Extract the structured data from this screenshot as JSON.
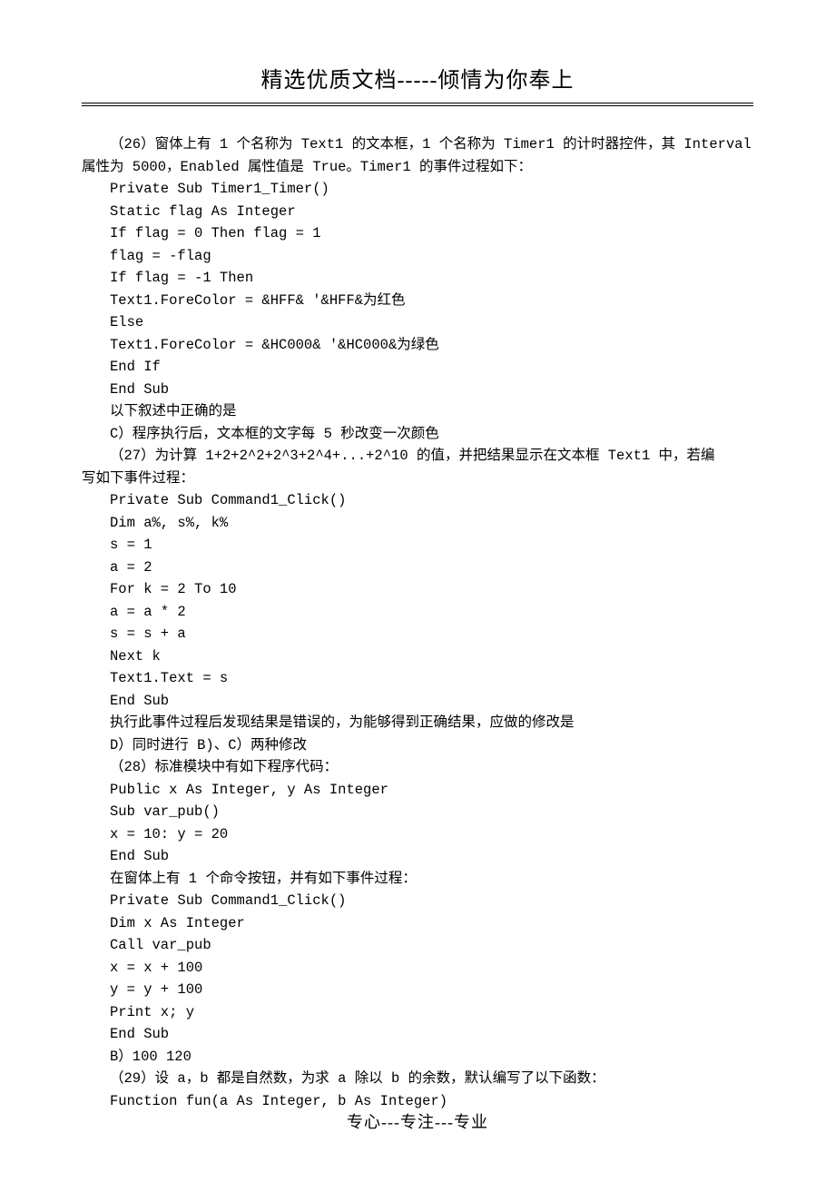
{
  "header": {
    "title": "精选优质文档-----倾情为你奉上"
  },
  "lines": [
    {
      "cls": "para",
      "t": "（26）窗体上有 1 个名称为 Text1 的文本框，1 个名称为 Timer1 的计时器控件，其 Interval"
    },
    {
      "cls": "",
      "t": "属性为 5000，Enabled 属性值是 True。Timer1 的事件过程如下："
    },
    {
      "cls": "code",
      "t": "Private Sub Timer1_Timer()"
    },
    {
      "cls": "code",
      "t": "Static flag As Integer"
    },
    {
      "cls": "code",
      "t": "If flag = 0 Then flag = 1"
    },
    {
      "cls": "code",
      "t": "flag = -flag"
    },
    {
      "cls": "code",
      "t": "If flag = -1 Then"
    },
    {
      "cls": "code",
      "t": "Text1.ForeColor = &HFF& '&HFF&为红色"
    },
    {
      "cls": "code",
      "t": "Else"
    },
    {
      "cls": "code",
      "t": "Text1.ForeColor = &HC000& '&HC000&为绿色"
    },
    {
      "cls": "code",
      "t": "End If"
    },
    {
      "cls": "code",
      "t": "End Sub"
    },
    {
      "cls": "para",
      "t": "以下叙述中正确的是"
    },
    {
      "cls": "para",
      "t": "C）程序执行后，文本框的文字每 5 秒改变一次颜色"
    },
    {
      "cls": "para",
      "t": "（27）为计算 1+2+2^2+2^3+2^4+...+2^10 的值，并把结果显示在文本框 Text1 中，若编"
    },
    {
      "cls": "",
      "t": "写如下事件过程："
    },
    {
      "cls": "code",
      "t": "Private Sub Command1_Click()"
    },
    {
      "cls": "code",
      "t": "Dim a%, s%, k%"
    },
    {
      "cls": "code",
      "t": "s = 1"
    },
    {
      "cls": "code",
      "t": "a = 2"
    },
    {
      "cls": "code",
      "t": "For k = 2 To 10"
    },
    {
      "cls": "code",
      "t": "a = a * 2"
    },
    {
      "cls": "code",
      "t": "s = s + a"
    },
    {
      "cls": "code",
      "t": "Next k"
    },
    {
      "cls": "code",
      "t": "Text1.Text = s"
    },
    {
      "cls": "code",
      "t": "End Sub"
    },
    {
      "cls": "para",
      "t": "执行此事件过程后发现结果是错误的，为能够得到正确结果，应做的修改是"
    },
    {
      "cls": "para",
      "t": "D）同时进行 B)、C）两种修改"
    },
    {
      "cls": "para",
      "t": "（28）标准模块中有如下程序代码："
    },
    {
      "cls": "code",
      "t": "Public x As Integer, y As Integer"
    },
    {
      "cls": "code",
      "t": "Sub var_pub()"
    },
    {
      "cls": "code",
      "t": "x = 10: y = 20"
    },
    {
      "cls": "code",
      "t": "End Sub"
    },
    {
      "cls": "para",
      "t": "在窗体上有 1 个命令按钮，并有如下事件过程："
    },
    {
      "cls": "code",
      "t": "Private Sub Command1_Click()"
    },
    {
      "cls": "code",
      "t": "Dim x As Integer"
    },
    {
      "cls": "code",
      "t": "Call var_pub"
    },
    {
      "cls": "code",
      "t": "x = x + 100"
    },
    {
      "cls": "code",
      "t": "y = y + 100"
    },
    {
      "cls": "code",
      "t": "Print x; y"
    },
    {
      "cls": "code",
      "t": "End Sub"
    },
    {
      "cls": "para",
      "t": "B）100 120"
    },
    {
      "cls": "para",
      "t": "（29）设 a，b 都是自然数，为求 a 除以 b 的余数，默认编写了以下函数："
    },
    {
      "cls": "code",
      "t": "Function fun(a As Integer, b As Integer)"
    }
  ],
  "footer": {
    "text": "专心---专注---专业"
  }
}
